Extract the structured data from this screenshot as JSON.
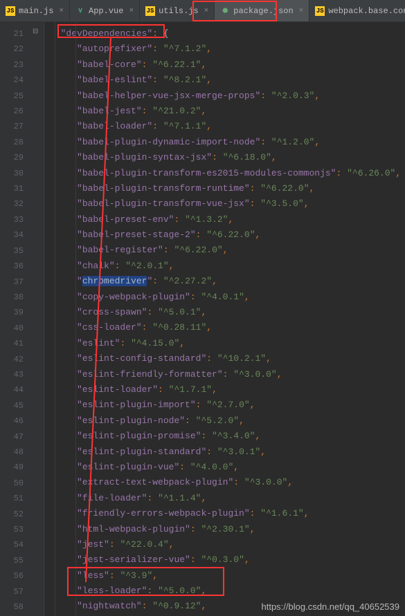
{
  "tabs": [
    {
      "label": "main.js",
      "type": "js"
    },
    {
      "label": "App.vue",
      "type": "vue"
    },
    {
      "label": "utils.js",
      "type": "js"
    },
    {
      "label": "package.json",
      "type": "json",
      "active": true
    },
    {
      "label": "webpack.base.conf.js",
      "type": "js"
    }
  ],
  "gutter_start": 21,
  "gutter_end": 58,
  "devDeps_label": "devDependencies",
  "selected_key": "chromedriver",
  "deps": {
    "autoprefixer": "^7.1.2",
    "babel-core": "^6.22.1",
    "babel-eslint": "^8.2.1",
    "babel-helper-vue-jsx-merge-props": "^2.0.3",
    "babel-jest": "^21.0.2",
    "babel-loader": "^7.1.1",
    "babel-plugin-dynamic-import-node": "^1.2.0",
    "babel-plugin-syntax-jsx": "^6.18.0",
    "babel-plugin-transform-es2015-modules-commonjs": "^6.26.0",
    "babel-plugin-transform-runtime": "^6.22.0",
    "babel-plugin-transform-vue-jsx": "^3.5.0",
    "babel-preset-env": "^1.3.2",
    "babel-preset-stage-2": "^6.22.0",
    "babel-register": "^6.22.0",
    "chalk": "^2.0.1",
    "chromedriver": "^2.27.2",
    "copy-webpack-plugin": "^4.0.1",
    "cross-spawn": "^5.0.1",
    "css-loader": "^0.28.11",
    "eslint": "^4.15.0",
    "eslint-config-standard": "^10.2.1",
    "eslint-friendly-formatter": "^3.0.0",
    "eslint-loader": "^1.7.1",
    "eslint-plugin-import": "^2.7.0",
    "eslint-plugin-node": "^5.2.0",
    "eslint-plugin-promise": "^3.4.0",
    "eslint-plugin-standard": "^3.0.1",
    "eslint-plugin-vue": "^4.0.0",
    "extract-text-webpack-plugin": "^3.0.0",
    "file-loader": "^1.1.4",
    "friendly-errors-webpack-plugin": "^1.6.1",
    "html-webpack-plugin": "^2.30.1",
    "jest": "^22.0.4",
    "jest-serializer-vue": "^0.3.0",
    "less": "^3.9",
    "less-loader": "^5.0.0",
    "nightwatch": "^0.9.12"
  },
  "watermark": "https://blog.csdn.net/qq_40652539"
}
